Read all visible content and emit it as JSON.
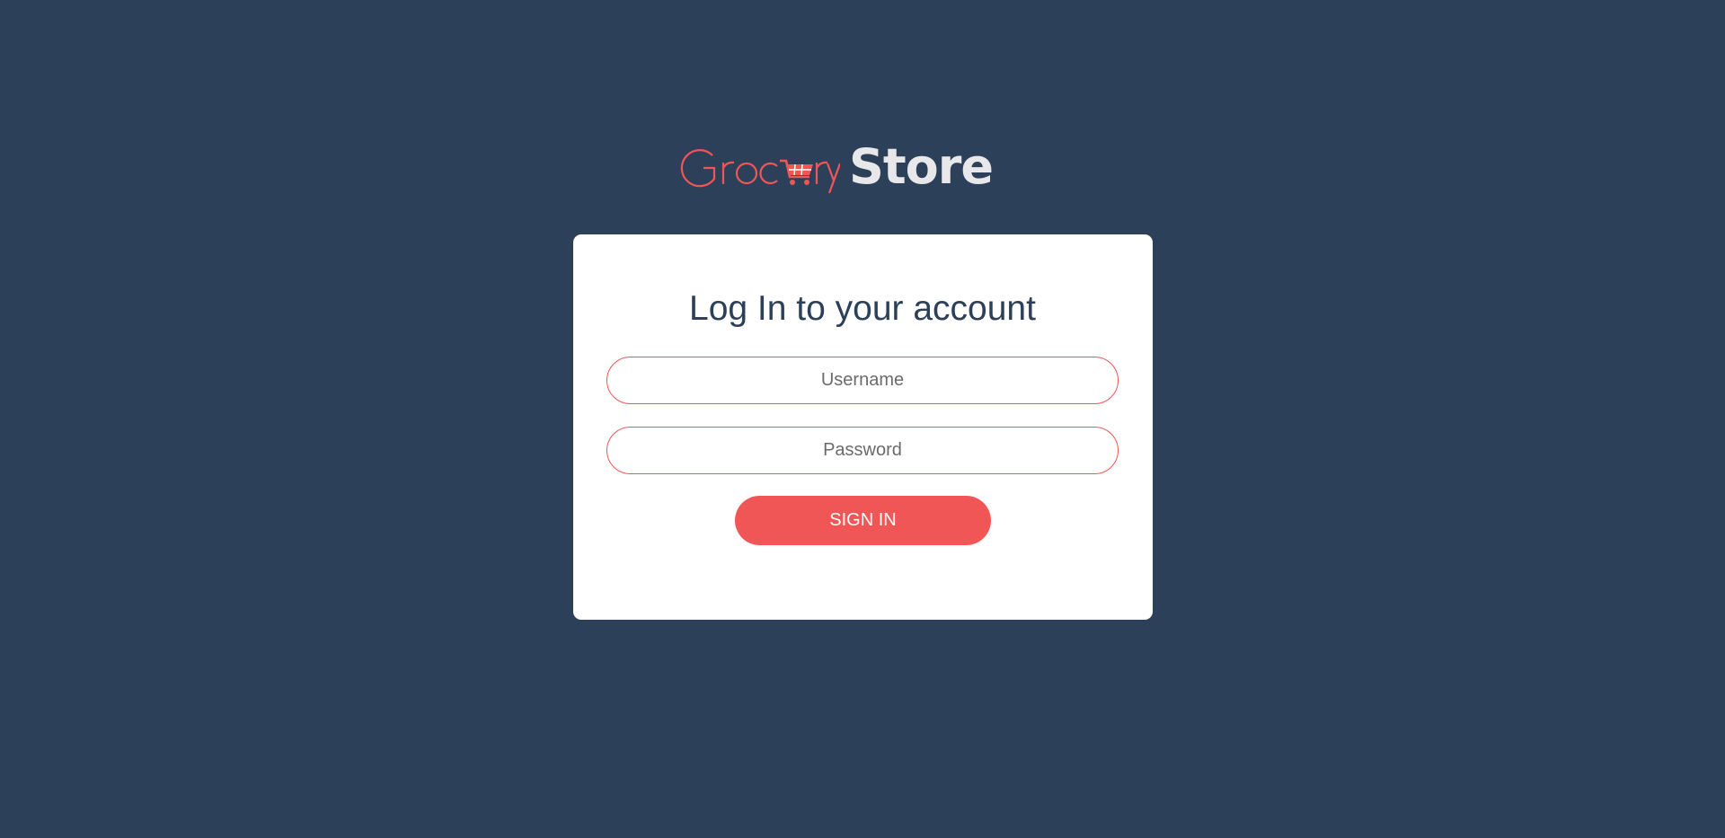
{
  "brand": {
    "name_part1": "Grocery",
    "name_part2": "Store",
    "accent_color": "#f05656",
    "background_color": "#2d405a"
  },
  "login": {
    "title": "Log In to your account",
    "username": {
      "value": "",
      "placeholder": "Username"
    },
    "password": {
      "value": "",
      "placeholder": "Password"
    },
    "submit_label": "SIGN IN"
  }
}
